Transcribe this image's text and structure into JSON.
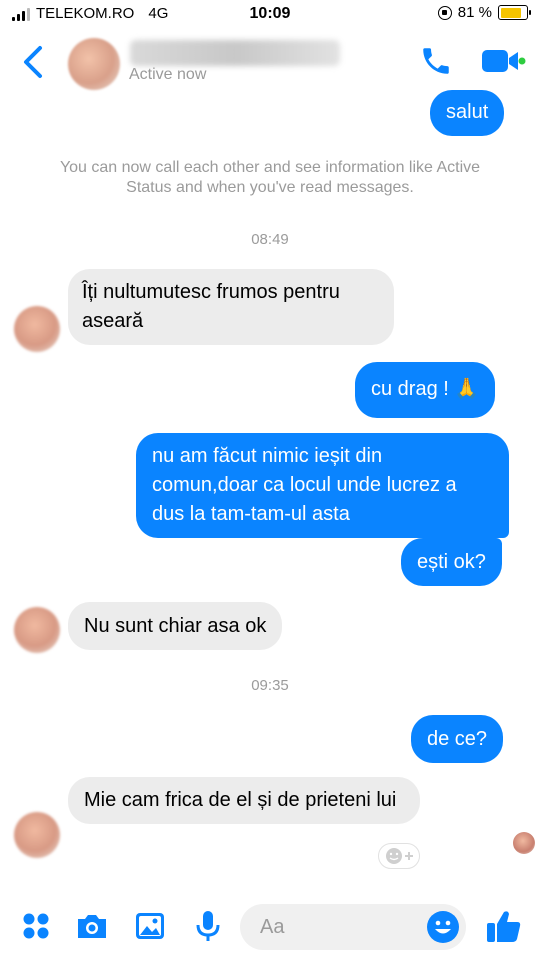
{
  "status_bar": {
    "carrier": "TELEKOM.RO",
    "network": "4G",
    "time": "10:09",
    "battery_percent": "81 %",
    "battery_level": 0.81
  },
  "header": {
    "contact_name": "",
    "contact_status": "Active now"
  },
  "colors": {
    "accent": "#0a84ff",
    "incoming_bubble": "#ececec",
    "meta_text": "#9b9b9b"
  },
  "conversation": {
    "msg_salut": "salut",
    "notice": "You can now call each other and see information like Active Status and when you've read messages.",
    "time_1": "08:49",
    "msg_in_1": "Îți nultumutesc frumos pentru aseară",
    "msg_out_2": "cu drag ! 🙏",
    "msg_out_3": "nu am făcut nimic ieșit din comun,doar ca locul unde lucrez a dus la tam-tam-ul asta",
    "msg_out_4": "ești ok?",
    "msg_in_5": "Nu sunt chiar asa ok",
    "time_2": "09:35",
    "msg_out_6": "de ce?",
    "msg_in_7": "Mie cam frica de el și de prieteni lui"
  },
  "composer": {
    "placeholder": "Aa"
  }
}
